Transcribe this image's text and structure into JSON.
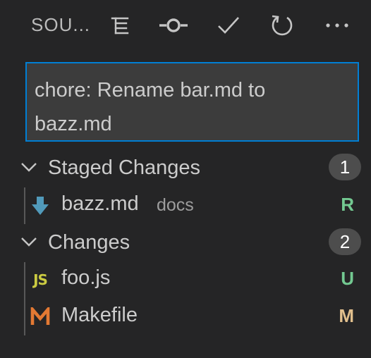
{
  "header": {
    "title": "SOU...",
    "icons": [
      "tree-view-icon",
      "commit-icon",
      "check-icon",
      "refresh-icon",
      "more-icon"
    ]
  },
  "commit_message": {
    "value": "chore: Rename bar.md to\nbazz.md"
  },
  "staged": {
    "label": "Staged Changes",
    "count": "1",
    "files": [
      {
        "name": "bazz.md",
        "description": "docs",
        "status": "R",
        "status_color": "#73c991",
        "icon": "markdown-download-icon",
        "icon_color": "#519aba"
      }
    ]
  },
  "changes": {
    "label": "Changes",
    "count": "2",
    "files": [
      {
        "name": "foo.js",
        "status": "U",
        "status_color": "#73c991",
        "icon": "javascript-icon",
        "icon_label": "JS",
        "icon_color": "#cbcb41"
      },
      {
        "name": "Makefile",
        "status": "M",
        "status_color": "#e2c08d",
        "icon": "makefile-icon",
        "icon_color": "#e37933"
      }
    ]
  },
  "colors": {
    "background": "#252526",
    "input_background": "#3c3c3c",
    "focus_border": "#007fd4",
    "badge_background": "#4d4d4d"
  }
}
